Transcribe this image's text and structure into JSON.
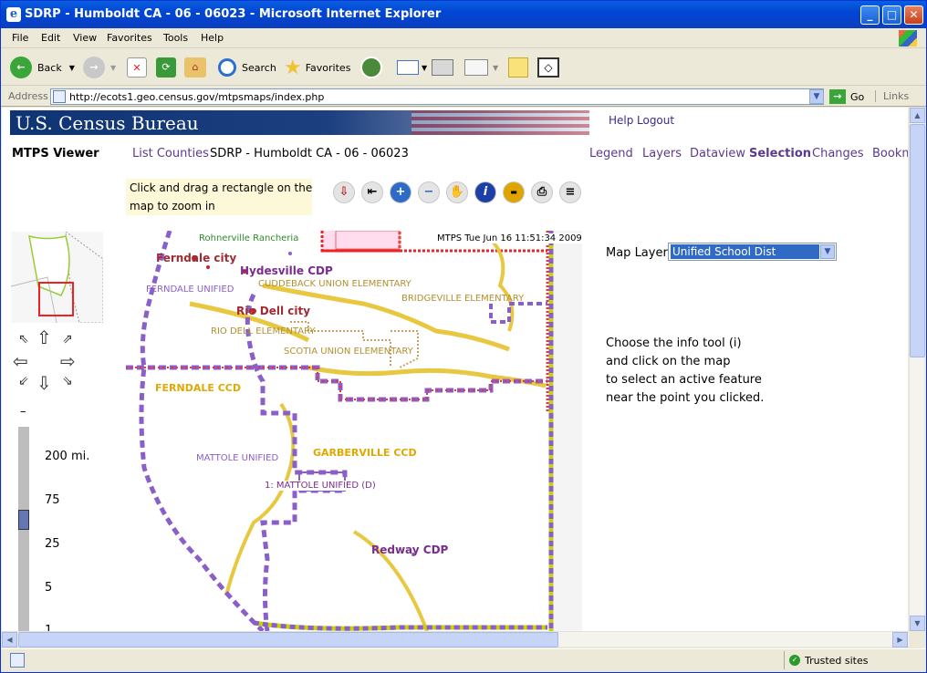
{
  "window": {
    "title": "SDRP - Humboldt CA - 06 - 06023 - Microsoft Internet Explorer"
  },
  "menu": [
    "File",
    "Edit",
    "View",
    "Favorites",
    "Tools",
    "Help"
  ],
  "toolbar": {
    "back": "Back",
    "search": "Search",
    "favorites": "Favorites"
  },
  "address": {
    "label": "Address",
    "url": "http://ecots1.geo.census.gov/mtpsmaps/index.php",
    "go": "Go",
    "links": "Links"
  },
  "page": {
    "banner_title": "U.S. Census Bureau",
    "help": "Help",
    "logout": "Logout",
    "app_name": "MTPS Viewer",
    "list_counties": "List Counties",
    "county_title": "SDRP - Humboldt CA - 06 - 06023",
    "tabs": [
      "Legend",
      "Layers",
      "Dataview",
      "Selection",
      "Changes",
      "Bookm"
    ],
    "hint": [
      "Click and drag a rectangle on the",
      "map to zoom in"
    ],
    "map_stamp": "MTPS Tue Jun 16 11:51:34 2009",
    "map_labels": {
      "rohnerville": "Rohnerville Rancheria",
      "ferndale_city": "Ferndale city",
      "hydesville": "Hydesville CDP",
      "ferndale_unified": "FERNDALE UNIFIED",
      "cuddeback": "CUDDEBACK UNION ELEMENTARY",
      "bridgeville": "BRIDGEVILLE ELEMENTARY",
      "rio_dell_city": "Rio Dell city",
      "rio_dell_elem": "RIO DELL ELEMENTARY",
      "scotia": "SCOTIA UNION ELEMENTARY",
      "ferndale_ccd": "FERNDALE CCD",
      "mattole_unified": "MATTOLE UNIFIED",
      "garberville": "GARBERVILLE CCD",
      "mattole_d": "1: MATTOLE UNIFIED (D)",
      "redway": "Redway CDP"
    },
    "scale_labels": [
      "–",
      "200 mi.",
      "75",
      "25",
      "5",
      "1"
    ],
    "map_layer_label": "Map Layer",
    "map_layer_value": "Unified School Dist",
    "instructions": [
      "Choose the info tool (i)",
      "and click on the map",
      "to select an active feature",
      "near the point you clicked."
    ]
  },
  "status": {
    "zone": "Trusted sites"
  }
}
